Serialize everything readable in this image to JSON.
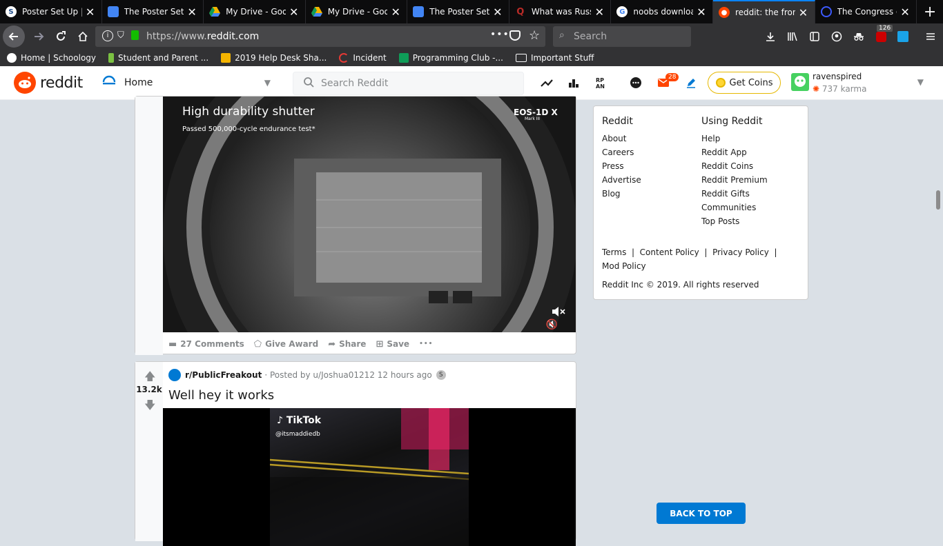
{
  "browser": {
    "tabs": [
      {
        "title": "Poster Set Up | S",
        "icon": "schoology-icon",
        "color": "#1e4b8a"
      },
      {
        "title": "The Poster Set U",
        "icon": "google-docs-icon",
        "color": "#4285f4"
      },
      {
        "title": "My Drive - Googl",
        "icon": "google-drive-icon",
        "color": "#f4b400"
      },
      {
        "title": "My Drive - Googl",
        "icon": "google-drive-icon",
        "color": "#f4b400"
      },
      {
        "title": "The Poster Set U",
        "icon": "google-docs-icon",
        "color": "#4285f4"
      },
      {
        "title": "What was Russia",
        "icon": "quora-icon",
        "color": "#b92b27"
      },
      {
        "title": "noobs download",
        "icon": "google-icon",
        "color": "#ffffff"
      },
      {
        "title": "reddit: the front p",
        "icon": "reddit-icon",
        "color": "#ff4500",
        "active": true
      },
      {
        "title": "The Congress of",
        "icon": "globe-icon",
        "color": "#3d5afe"
      }
    ],
    "url": "https://www.reddit.com",
    "url_prefix": "https://www.",
    "url_domain": "reddit.com",
    "search_placeholder": "Search",
    "extension_badge": "126",
    "bookmarks": [
      {
        "label": "Home | Schoology"
      },
      {
        "label": "Student and Parent ..."
      },
      {
        "label": "2019 Help Desk Sha..."
      },
      {
        "label": "Incident"
      },
      {
        "label": "Programming Club -..."
      },
      {
        "label": "Important Stuff"
      }
    ]
  },
  "reddit": {
    "logo_text": "reddit",
    "home_label": "Home",
    "search_placeholder": "Search Reddit",
    "mail_badge": "28",
    "coins_label": "Get Coins",
    "username": "ravenspired",
    "karma": "737 karma",
    "accent": "#ff4500",
    "blue": "#0079d3"
  },
  "post1": {
    "media_headline": "High durability shutter",
    "media_subtext": "Passed 500,000-cycle endurance test*",
    "media_brand": "EOS-1D X",
    "media_brand_sub": "Mark III",
    "comments": "27 Comments",
    "give_award": "Give Award",
    "share": "Share",
    "save": "Save",
    "more": "•••"
  },
  "post2": {
    "score": "13.2k",
    "subreddit": "r/PublicFreakout",
    "posted_by": "· Posted by u/Joshua01212 12 hours ago",
    "title": "Well hey it works",
    "tiktok_label": "TikTok",
    "tiktok_handle": "@itsmaddiedb"
  },
  "sidebar": {
    "col1_title": "Reddit",
    "col1": [
      "About",
      "Careers",
      "Press",
      "Advertise",
      "Blog"
    ],
    "col2_title": "Using Reddit",
    "col2": [
      "Help",
      "Reddit App",
      "Reddit Coins",
      "Reddit Premium",
      "Reddit Gifts",
      "Communities",
      "Top Posts"
    ],
    "terms": "Terms",
    "content_policy": "Content Policy",
    "privacy_policy": "Privacy Policy",
    "mod_policy": "Mod Policy",
    "copyright": "Reddit Inc © 2019. All rights reserved"
  },
  "back_to_top": "BACK TO TOP"
}
